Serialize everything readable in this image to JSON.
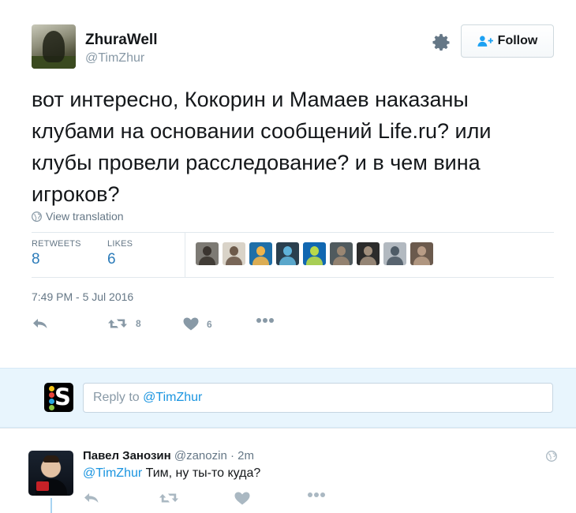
{
  "tweet": {
    "display_name": "ZhuraWell",
    "handle": "@TimZhur",
    "follow_label": "Follow",
    "text": "вот интересно, Кокорин и Мамаев наказаны клубами на основании сообщений Life.ru? или клубы провели расследование? и в чем вина игроков?",
    "view_translation": "View translation",
    "retweets_label": "RETWEETS",
    "retweets_count": "8",
    "likes_label": "LIKES",
    "likes_count": "6",
    "timestamp": "7:49 PM - 5 Jul 2016",
    "action_retweet_count": "8",
    "action_like_count": "6",
    "icons": [
      "gear-icon",
      "follow-user-icon",
      "globe-icon",
      "reply-icon",
      "retweet-icon",
      "heart-icon",
      "more-icon"
    ]
  },
  "likers": [
    {
      "bg": "#7d7a74",
      "fg": "#3b3530"
    },
    {
      "bg": "#d9d3c8",
      "fg": "#6d5a4a"
    },
    {
      "bg": "#1f6fa8",
      "fg": "#f0b44a"
    },
    {
      "bg": "#2a3f4e",
      "fg": "#5fb2d9"
    },
    {
      "bg": "#1167b1",
      "fg": "#b9d94a"
    },
    {
      "bg": "#505a5e",
      "fg": "#9a8672"
    },
    {
      "bg": "#2b2b2b",
      "fg": "#a08e7c"
    },
    {
      "bg": "#b2b9c0",
      "fg": "#4e5b66"
    },
    {
      "bg": "#6b5a4d",
      "fg": "#b89c86"
    }
  ],
  "reply_box": {
    "prefix": "Reply to ",
    "mention": "@TimZhur"
  },
  "reply_tweet": {
    "display_name": "Павел Занозин",
    "handle": "@zanozin",
    "separator": " · ",
    "time": "2m",
    "mention": "@TimZhur",
    "text": " Тим, ну ты-то куда?"
  },
  "colors": {
    "link": "#1b95e0",
    "stat_value": "#2b7bb9",
    "muted": "#657786",
    "reply_bg": "#e8f5fd"
  }
}
